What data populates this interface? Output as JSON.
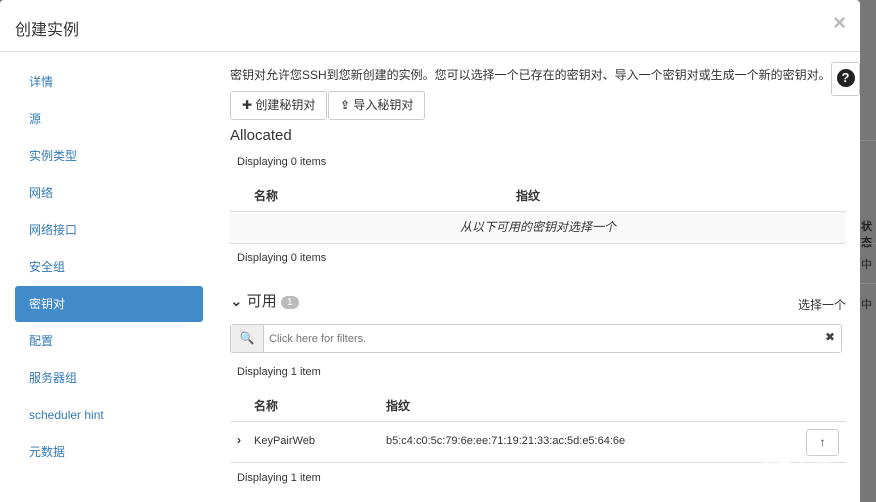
{
  "modal": {
    "title": "创建实例",
    "close": "×"
  },
  "sidebar": {
    "items": [
      {
        "label": "详情"
      },
      {
        "label": "源"
      },
      {
        "label": "实例类型"
      },
      {
        "label": "网络"
      },
      {
        "label": "网络接口"
      },
      {
        "label": "安全组"
      },
      {
        "label": "密钥对",
        "active": true
      },
      {
        "label": "配置"
      },
      {
        "label": "服务器组"
      },
      {
        "label": "scheduler hint"
      },
      {
        "label": "元数据"
      }
    ]
  },
  "main": {
    "description": "密钥对允许您SSH到您新创建的实例。您可以选择一个已存在的密钥对、导入一个密钥对或生成一个新的密钥对。",
    "help": "?",
    "create_button": "创建秘钥对",
    "import_button": "导入秘钥对",
    "allocated": {
      "title": "Allocated",
      "count_top": "Displaying 0 items",
      "columns": [
        "名称",
        "指纹"
      ],
      "empty": "从以下可用的密钥对选择一个",
      "count_bottom": "Displaying 0 items"
    },
    "available": {
      "title": "可用",
      "badge": "1",
      "select_hint": "选择一个",
      "filter_placeholder": "Click here for filters.",
      "count_top": "Displaying 1 item",
      "columns": [
        "名称",
        "指纹"
      ],
      "rows": [
        {
          "name": "KeyPairWeb",
          "fingerprint": "b5:c4:c0:5c:79:6e:ee:71:19:21:33:ac:5d:e5:64:6e"
        }
      ],
      "count_bottom": "Displaying 1 item"
    }
  },
  "background": {
    "texts": [
      "状态",
      "中",
      "中"
    ]
  },
  "watermark": "创新互联"
}
